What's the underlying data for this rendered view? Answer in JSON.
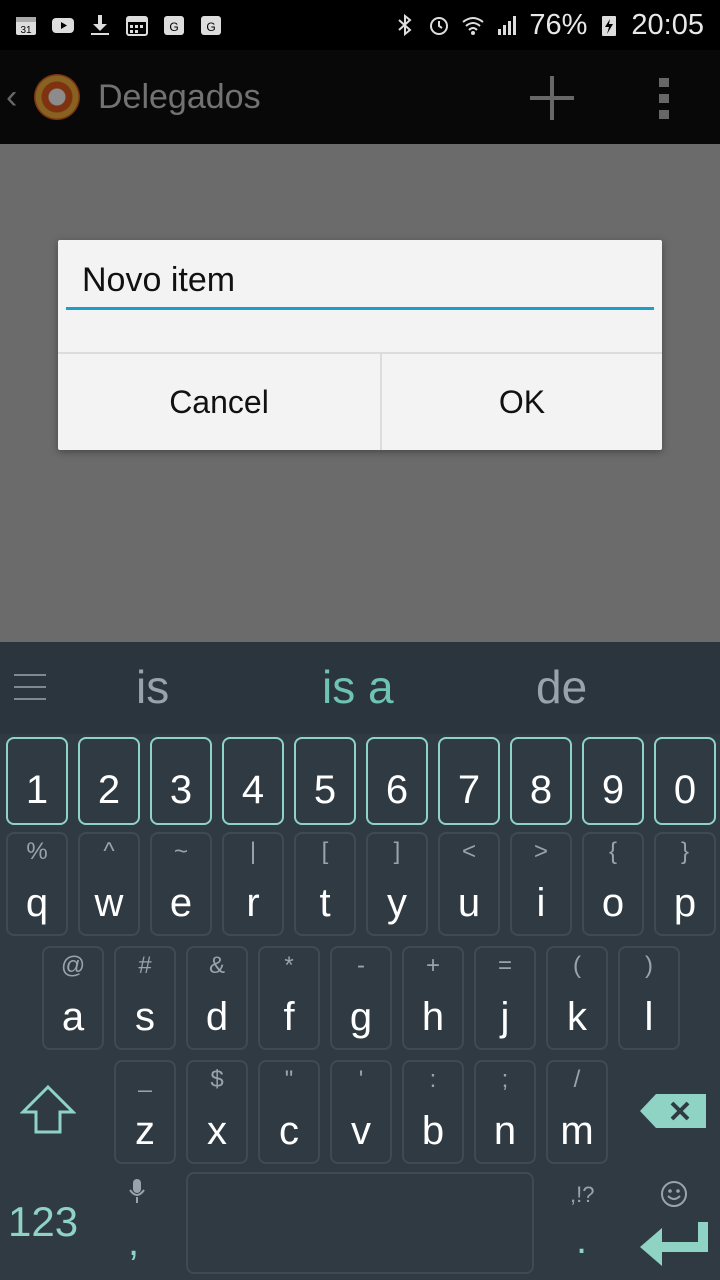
{
  "status_bar": {
    "left_icons": [
      "calendar-icon",
      "youtube-icon",
      "download-icon",
      "calendar-grid-icon",
      "maps-icon",
      "maps-icon"
    ],
    "battery": "76%",
    "time": "20:05"
  },
  "action_bar": {
    "title": "Delegados"
  },
  "dialog": {
    "input_value": "Novo item",
    "cancel_label": "Cancel",
    "ok_label": "OK"
  },
  "keyboard": {
    "suggestions": [
      "is",
      "is a",
      "de"
    ],
    "numbers": [
      "1",
      "2",
      "3",
      "4",
      "5",
      "6",
      "7",
      "8",
      "9",
      "0"
    ],
    "row1": [
      {
        "main": "q",
        "sub": "%"
      },
      {
        "main": "w",
        "sub": "^"
      },
      {
        "main": "e",
        "sub": "~"
      },
      {
        "main": "r",
        "sub": "|"
      },
      {
        "main": "t",
        "sub": "["
      },
      {
        "main": "y",
        "sub": "]"
      },
      {
        "main": "u",
        "sub": "<"
      },
      {
        "main": "i",
        "sub": ">"
      },
      {
        "main": "o",
        "sub": "{"
      },
      {
        "main": "p",
        "sub": "}"
      }
    ],
    "row2": [
      {
        "main": "a",
        "sub": "@"
      },
      {
        "main": "s",
        "sub": "#"
      },
      {
        "main": "d",
        "sub": "&"
      },
      {
        "main": "f",
        "sub": "*"
      },
      {
        "main": "g",
        "sub": "-"
      },
      {
        "main": "h",
        "sub": "+"
      },
      {
        "main": "j",
        "sub": "="
      },
      {
        "main": "k",
        "sub": "("
      },
      {
        "main": "l",
        "sub": ")"
      }
    ],
    "row3": [
      {
        "main": "z",
        "sub": "_"
      },
      {
        "main": "x",
        "sub": "$"
      },
      {
        "main": "c",
        "sub": "\""
      },
      {
        "main": "v",
        "sub": "'"
      },
      {
        "main": "b",
        "sub": ":"
      },
      {
        "main": "n",
        "sub": ";"
      },
      {
        "main": "m",
        "sub": "/"
      }
    ],
    "mode_label": "123",
    "comma": ",",
    "punct_label": ",!?",
    "period": ".",
    "accent_color": "#8fd3c5"
  }
}
